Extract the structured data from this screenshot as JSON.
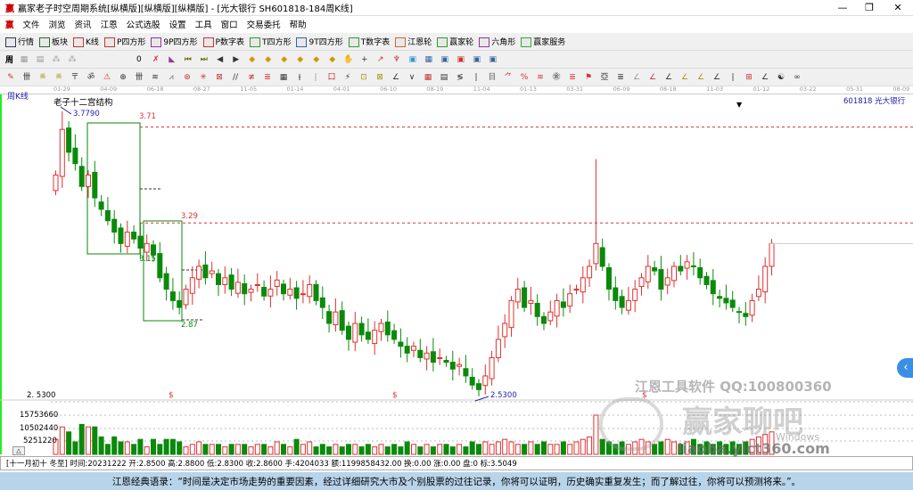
{
  "window": {
    "title": "赢家老子时空周期系统[纵横版][纵横版][纵横版] - [光大银行  SH601818-184周K线]",
    "min": "—",
    "max": "❐",
    "close": "✕"
  },
  "menu": [
    "文件",
    "浏览",
    "资讯",
    "江恩",
    "公式选股",
    "设置",
    "工具",
    "窗口",
    "交易委托",
    "帮助"
  ],
  "toolbar1": [
    {
      "icon": "quote-icon",
      "label": "行情"
    },
    {
      "icon": "sector-icon",
      "label": "板块"
    },
    {
      "icon": "kline-icon",
      "label": "K线"
    },
    {
      "icon": "p-square-icon",
      "label": "P四方形"
    },
    {
      "icon": "9p-square-icon",
      "label": "9P四方形"
    },
    {
      "icon": "p-number-icon",
      "label": "P数字表"
    },
    {
      "icon": "t-square-icon",
      "label": "T四方形"
    },
    {
      "icon": "9t-square-icon",
      "label": "9T四方形"
    },
    {
      "icon": "t-number-icon",
      "label": "T数字表"
    },
    {
      "icon": "gann-wheel-icon",
      "label": "江恩轮"
    },
    {
      "icon": "winner-wheel-icon",
      "label": "赢家轮"
    },
    {
      "icon": "hexagon-icon",
      "label": "六角形"
    },
    {
      "icon": "dollar-icon",
      "label": "赢家服务"
    }
  ],
  "toolbar2_text": {
    "period": "周",
    "zero": "0"
  },
  "date_ticks": [
    "01-29",
    "04-09",
    "06-18",
    "08-27",
    "11-05",
    "01-14",
    "04-01",
    "06-10",
    "08-19",
    "11-04",
    "01-13",
    "03-31",
    "06-09",
    "08-18",
    "11-03",
    "01-12",
    "03-22",
    "05-31",
    "08-09"
  ],
  "chart_header": {
    "period": "周K线",
    "structure": "老子十二宫结构",
    "stock": "601818 光大银行"
  },
  "annotations": {
    "high": "3.7790",
    "l1": "3.71",
    "l2": "3.29",
    "l3": "3.15",
    "l4": "2.87",
    "low": "2.5300",
    "low_axis": "2. 5300",
    "dollar": "$"
  },
  "volume_axis": [
    "15753660",
    "10502440",
    "5251220"
  ],
  "watermark": {
    "line1": "江恩工具软件  QQ:100800360",
    "line2": "赢家聊吧",
    "line3": "liaoba.yict360.com",
    "win": "Windows"
  },
  "status": "[十一月初十 冬至] 时间:20231222 开:2.8500 高:2.8800 低:2.8300 收:2.8600 手:4204033 额:1199858432.00 换:0.00 涨:0.00 盘:0 标:3.5049",
  "banner": "江恩经典语录：“时间是决定市场走势的重要因素，经过详细研究大市及个别股票的过往记录，你将可以证明，历史确实重复发生；而了解过往，你将可以预测将来。”。",
  "colors": {
    "up": "#e03030",
    "down": "#0a8a0a",
    "line": "#e03030",
    "box": "#0a8a0a",
    "blue": "#2020b0"
  },
  "chart_data": {
    "type": "candlestick",
    "price_range": [
      2.53,
      3.779
    ],
    "closes": [
      3.5,
      3.7,
      3.6,
      3.55,
      3.45,
      3.5,
      3.4,
      3.35,
      3.3,
      3.25,
      3.2,
      3.25,
      3.22,
      3.18,
      3.2,
      3.15,
      3.05,
      3.0,
      2.95,
      2.92,
      3.0,
      3.05,
      3.1,
      3.05,
      3.08,
      3.02,
      3.05,
      3.0,
      3.03,
      2.98,
      3.0,
      3.02,
      2.97,
      3.0,
      3.04,
      2.98,
      3.0,
      2.96,
      2.98,
      3.02,
      2.95,
      2.92,
      2.85,
      2.9,
      2.82,
      2.78,
      2.85,
      2.8,
      2.78,
      2.82,
      2.85,
      2.8,
      2.78,
      2.75,
      2.72,
      2.75,
      2.7,
      2.72,
      2.68,
      2.7,
      2.68,
      2.65,
      2.67,
      2.62,
      2.58,
      2.56,
      2.62,
      2.7,
      2.78,
      2.85,
      2.95,
      3.0,
      2.92,
      2.95,
      2.88,
      2.85,
      2.9,
      2.95,
      2.92,
      2.98,
      3.0,
      3.05,
      3.1,
      3.2,
      3.1,
      3.0,
      2.95,
      2.92,
      2.95,
      3.0,
      3.05,
      3.1,
      3.08,
      3.0,
      3.05,
      3.1,
      3.08,
      3.12,
      3.1,
      3.05,
      3.02,
      2.98,
      2.96,
      2.94,
      2.92,
      2.9,
      2.88,
      2.95,
      3.0,
      3.1,
      3.2
    ],
    "volumes": [
      6,
      11,
      9,
      5,
      12,
      11,
      11,
      7,
      4,
      7,
      5,
      5,
      4,
      6,
      3,
      6,
      4,
      6,
      6,
      5,
      3,
      4,
      5,
      4,
      4,
      4,
      3,
      4,
      4,
      4,
      3,
      4,
      4,
      3,
      5,
      4,
      3,
      6,
      4,
      5,
      3,
      4,
      3,
      4,
      3,
      4,
      4,
      3,
      4,
      3,
      4,
      3,
      4,
      3,
      5,
      4,
      3,
      4,
      3,
      4,
      4,
      3,
      4,
      3,
      5,
      4,
      5,
      4,
      5,
      6,
      5,
      4,
      4,
      5,
      4,
      5,
      4,
      4,
      5,
      4,
      5,
      6,
      7,
      15.7,
      6,
      5,
      4,
      5,
      4,
      5,
      6,
      5,
      4,
      5,
      6,
      5,
      4,
      5,
      6,
      4,
      5,
      4,
      5,
      4,
      5,
      4,
      5,
      6,
      7,
      8,
      9
    ],
    "volume_unit": "million lots"
  }
}
